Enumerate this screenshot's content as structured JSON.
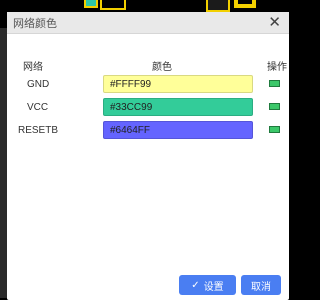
{
  "dialog": {
    "title": "网络颜色",
    "columns": {
      "net": "网络",
      "color": "颜色",
      "action": "操作"
    },
    "rows": [
      {
        "net": "GND",
        "color": "#FFFF99"
      },
      {
        "net": "VCC",
        "color": "#33CC99"
      },
      {
        "net": "RESETB",
        "color": "#6464FF"
      }
    ],
    "buttons": {
      "set": "设置",
      "cancel": "取消"
    }
  },
  "colors": {
    "accent": "#4A7EF2",
    "action_icon": "#3CC86A",
    "canvas_background": "#000000"
  },
  "icons": {
    "close": "close-icon",
    "action": "color-chip-icon",
    "set": "check-icon"
  }
}
